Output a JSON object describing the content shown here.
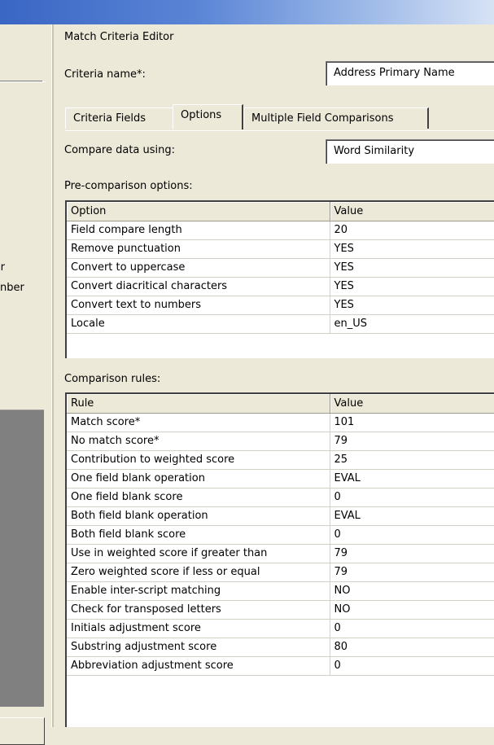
{
  "left_pane": {
    "text_1": "er",
    "text_2": "nber"
  },
  "editor": {
    "title": "Match Criteria Editor",
    "criteria_name_label": "Criteria name*:",
    "criteria_name_value": "Address Primary Name",
    "tabs": [
      {
        "label": "Criteria Fields",
        "active": false
      },
      {
        "label": "Options",
        "active": true
      },
      {
        "label": "Multiple Field Comparisons",
        "active": false
      }
    ],
    "compare_label": "Compare data using:",
    "compare_value": "Word Similarity",
    "pre_comparison_label": "Pre-comparison options:",
    "pre_comparison": {
      "headers": [
        "Option",
        "Value"
      ],
      "rows": [
        [
          "Field compare length",
          "20"
        ],
        [
          "Remove punctuation",
          "YES"
        ],
        [
          "Convert to uppercase",
          "YES"
        ],
        [
          "Convert diacritical characters",
          "YES"
        ],
        [
          "Convert text to numbers",
          "YES"
        ],
        [
          "Locale",
          "en_US"
        ]
      ]
    },
    "comparison_rules_label": "Comparison rules:",
    "comparison_rules": {
      "headers": [
        "Rule",
        "Value"
      ],
      "rows": [
        [
          "Match score*",
          "101"
        ],
        [
          "No match score*",
          "79"
        ],
        [
          "Contribution to weighted score",
          "25"
        ],
        [
          "One field blank operation",
          "EVAL"
        ],
        [
          "One field blank score",
          "0"
        ],
        [
          "Both field blank operation",
          "EVAL"
        ],
        [
          "Both field blank score",
          "0"
        ],
        [
          "Use in weighted score if greater than",
          "79"
        ],
        [
          "Zero weighted score if less or equal",
          "79"
        ],
        [
          "Enable inter-script matching",
          "NO"
        ],
        [
          "Check for transposed letters",
          "NO"
        ],
        [
          "Initials adjustment score",
          "0"
        ],
        [
          "Substring adjustment score",
          "80"
        ],
        [
          "Abbreviation adjustment score",
          "0"
        ]
      ]
    }
  },
  "colors": {
    "window_bg": "#ece9d8",
    "titlebar_start": "#3a66c4",
    "titlebar_end": "#d7e2f5",
    "grid_bg": "#ffffff"
  }
}
